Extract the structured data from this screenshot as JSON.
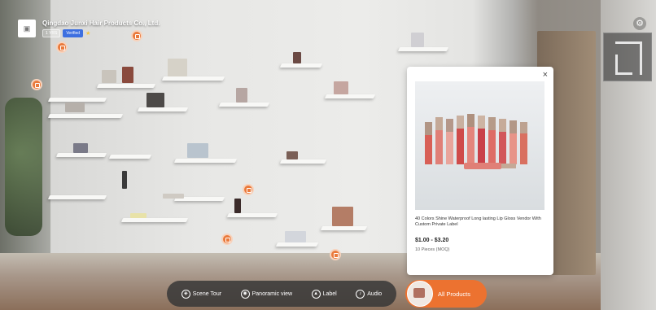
{
  "company": {
    "name": "Qingdao Junxi Hair Products Co., Ltd.",
    "badge_1": "1 YRS",
    "badge_2": "Verified",
    "logo_icon": "store-icon"
  },
  "popup": {
    "title": "40 Colors Shine Waterproof Long lasting Lip Gloss Vendor With Custom Private Label",
    "price": "$1.00 - $3.20",
    "moq": "10 Pieces (MOQ)",
    "close_label": "×"
  },
  "toolbar": {
    "items": [
      {
        "label": "Scene Tour",
        "icon": "compass-icon"
      },
      {
        "label": "Panoramic view",
        "icon": "panorama-icon"
      },
      {
        "label": "Label",
        "icon": "tag-icon"
      },
      {
        "label": "Audio",
        "icon": "audio-icon"
      }
    ]
  },
  "all_products": {
    "label": "All Products"
  },
  "settings_label": "⚙",
  "colors": {
    "accent": "#ec7230",
    "hotspot": "#ea7a3c",
    "toolbar_bg": "#373737"
  }
}
